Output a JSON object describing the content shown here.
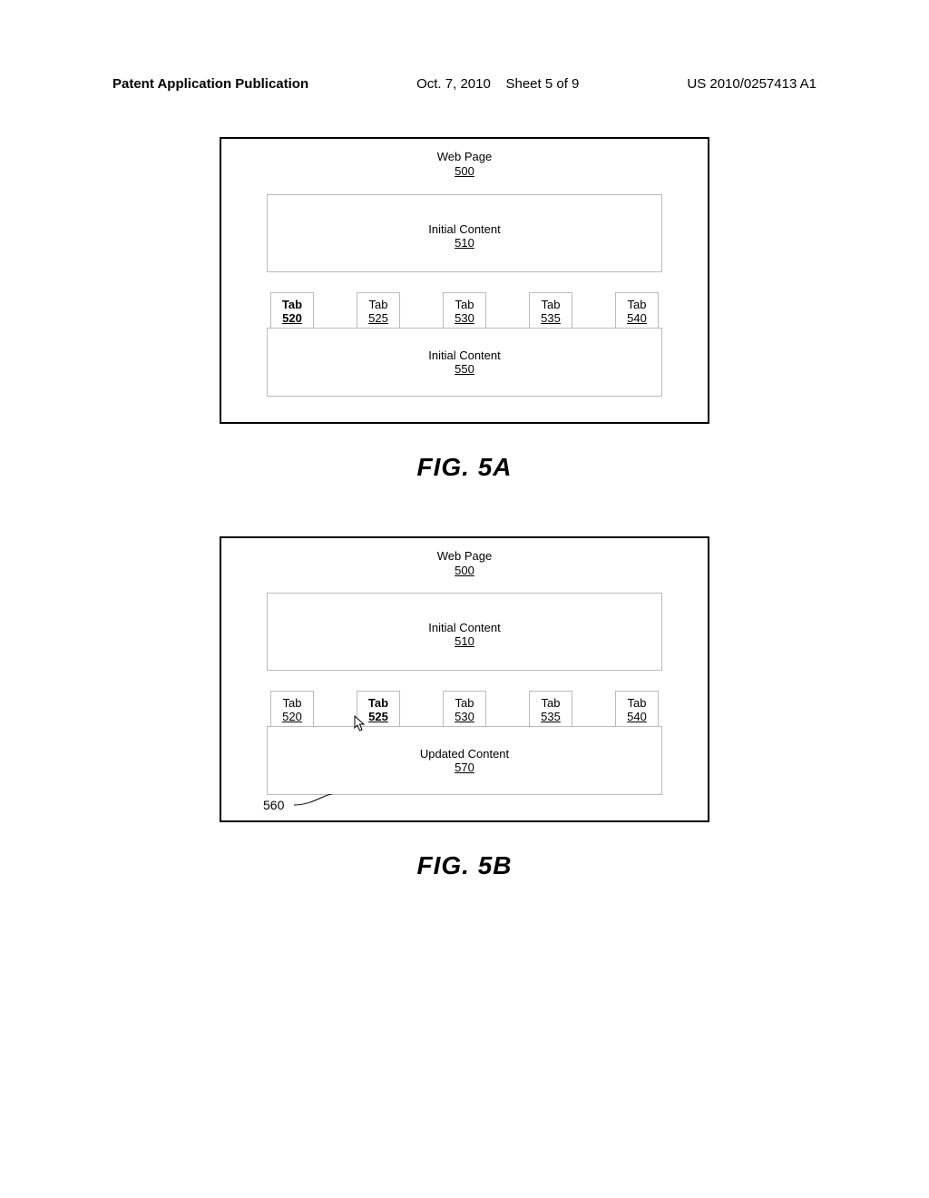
{
  "header": {
    "left": "Patent Application Publication",
    "date": "Oct. 7, 2010",
    "sheet": "Sheet 5 of 9",
    "pubno": "US 2010/0257413 A1"
  },
  "figA": {
    "page_label": "Web Page",
    "page_num": "500",
    "initial_label": "Initial Content",
    "initial_num": "510",
    "tabs": [
      {
        "label": "Tab",
        "num": "520",
        "active": true
      },
      {
        "label": "Tab",
        "num": "525",
        "active": false
      },
      {
        "label": "Tab",
        "num": "530",
        "active": false
      },
      {
        "label": "Tab",
        "num": "535",
        "active": false
      },
      {
        "label": "Tab",
        "num": "540",
        "active": false
      }
    ],
    "bottom_label": "Initial Content",
    "bottom_num": "550",
    "caption": "FIG. 5A"
  },
  "figB": {
    "page_label": "Web Page",
    "page_num": "500",
    "initial_label": "Initial Content",
    "initial_num": "510",
    "tabs": [
      {
        "label": "Tab",
        "num": "520",
        "active": false
      },
      {
        "label": "Tab",
        "num": "525",
        "active": true
      },
      {
        "label": "Tab",
        "num": "530",
        "active": false
      },
      {
        "label": "Tab",
        "num": "535",
        "active": false
      },
      {
        "label": "Tab",
        "num": "540",
        "active": false
      }
    ],
    "cursor_ref": "560",
    "bottom_label": "Updated Content",
    "bottom_num": "570",
    "caption": "FIG. 5B"
  }
}
